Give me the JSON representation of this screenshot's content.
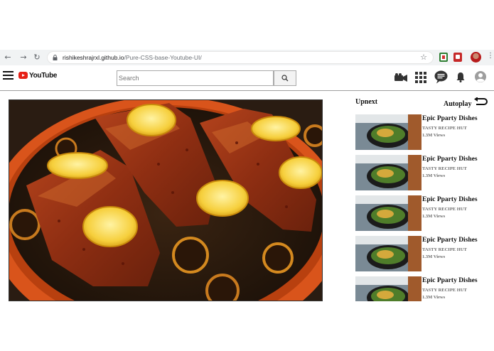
{
  "browser": {
    "url_domain": "rishikeshrajrxl.github.io",
    "url_path": "/Pure-CSS-base-Youtube-UI/",
    "icons": [
      "back-arrow-icon",
      "forward-arrow-icon",
      "reload-icon",
      "lock-icon",
      "star-icon",
      "menu-dots-icon"
    ]
  },
  "header": {
    "logo_text": "YouTube",
    "search_placeholder": "Search",
    "icons": [
      "hamburger-menu-icon",
      "video-camera-icon",
      "apps-grid-icon",
      "chat-icon",
      "bell-icon",
      "account-icon"
    ]
  },
  "sidebar": {
    "upnext_label": "Upnext",
    "autoplay_label": "Autoplay",
    "cards": [
      {
        "title": "Epic Pparty Dishes",
        "channel": "TASTY RECIPE HUT",
        "views": "1.3M Views"
      },
      {
        "title": "Epic Pparty Dishes",
        "channel": "TASTY RECIPE HUT",
        "views": "1.3M Views"
      },
      {
        "title": "Epic Pparty Dishes",
        "channel": "TASTY RECIPE HUT",
        "views": "1.3M Views"
      },
      {
        "title": "Epic Pparty Dishes",
        "channel": "TASTY RECIPE HUT",
        "views": "1.3M Views"
      },
      {
        "title": "Epic Pparty Dishes",
        "channel": "TASTY RECIPE HUT",
        "views": "1.3M Views"
      }
    ]
  },
  "colors": {
    "brand_red": "#e62117",
    "chrome_bg": "#f1f3f4",
    "meta_gray": "#6a6a6a"
  }
}
